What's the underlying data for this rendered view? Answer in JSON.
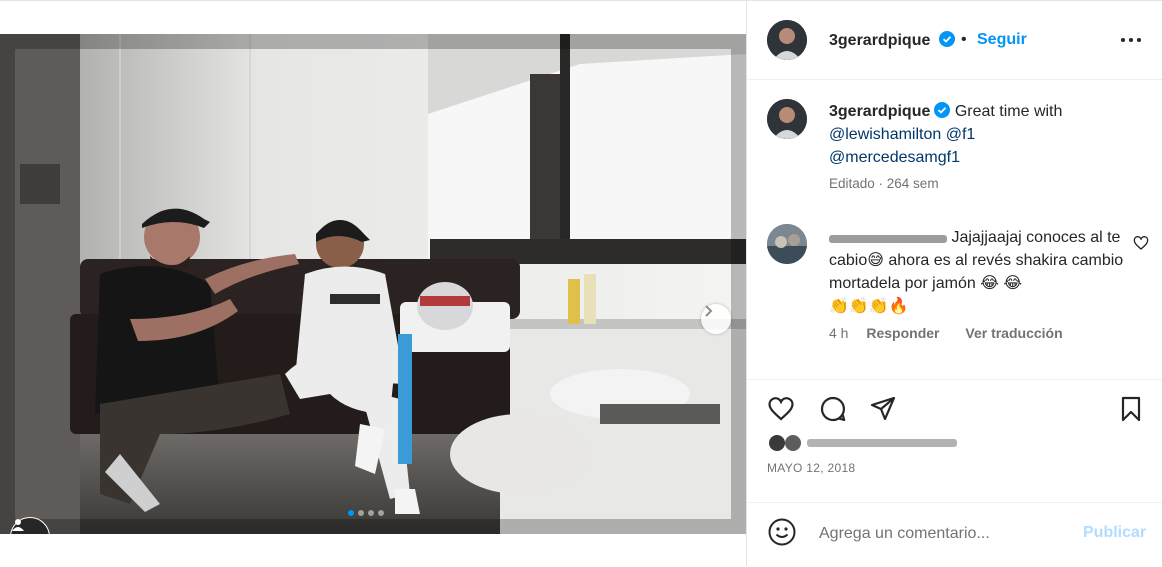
{
  "post": {
    "username": "3gerardpique",
    "follow_label": "Seguir",
    "separator": "•",
    "caption_text": "Great time with",
    "mentions": [
      "@lewishamilton",
      "@f1",
      "@mercedesamgf1"
    ],
    "caption_meta": "Editado · 264 sem",
    "date": "MAYO 12, 2018"
  },
  "comment": {
    "text_part1": "Jajajjaajaj conoces al te cabio",
    "emoji1": "😅",
    "text_part2": " ahora es al revés shakira cambio mortadela por jamón ",
    "emoji_tail": "😂 😂",
    "emoji_line2": "👏👏👏🔥",
    "time": "4 h",
    "reply_label": "Responder",
    "translate_label": "Ver traducción"
  },
  "composer": {
    "placeholder": "Agrega un comentario...",
    "publish_label": "Publicar"
  },
  "carousel": {
    "slides": 4,
    "active": 0
  },
  "colors": {
    "accent": "#0095f6",
    "publish_disabled": "#b3dbff",
    "verified": "#0095f6"
  },
  "icons": [
    "heart-icon",
    "comment-icon",
    "share-icon",
    "bookmark-icon",
    "emoji-icon",
    "more-icon",
    "verified-icon",
    "chevron-right-icon",
    "user-tag-icon"
  ]
}
